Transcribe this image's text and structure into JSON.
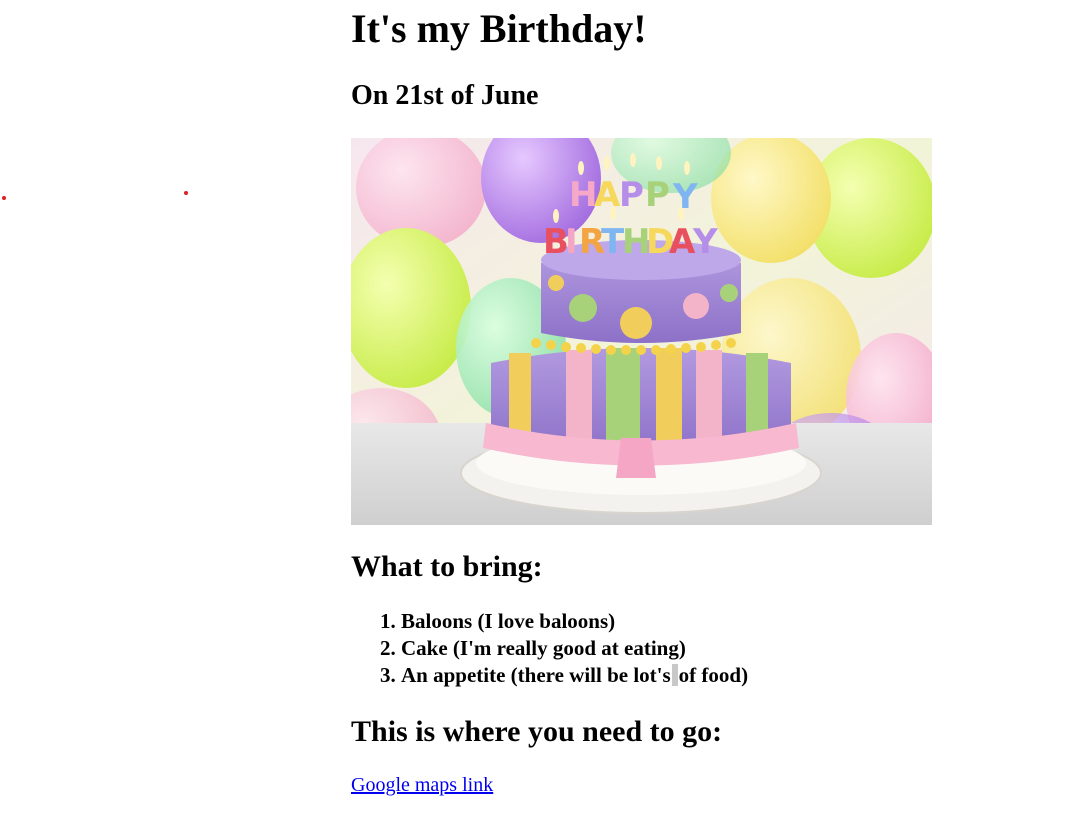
{
  "page": {
    "title": "It's my Birthday!",
    "subtitle": "On 21st of June"
  },
  "image": {
    "alt": "Happy Birthday cake with balloons",
    "candle_letters_top": "HAPPY",
    "candle_letters_bottom": "BIRTHDAY"
  },
  "bring": {
    "heading": "What to bring:",
    "items": [
      "Baloons (I love baloons)",
      "Cake (I'm really good at eating)",
      "An appetite (there will be lot's of food)"
    ],
    "item3_before_caret": "An appetite (there will be lot's",
    "item3_after_caret": "of food)"
  },
  "directions": {
    "heading": "This is where you need to go:",
    "link_text": "Google maps link"
  },
  "colors": {
    "link": "#0000ee",
    "dot": "#e02020"
  }
}
